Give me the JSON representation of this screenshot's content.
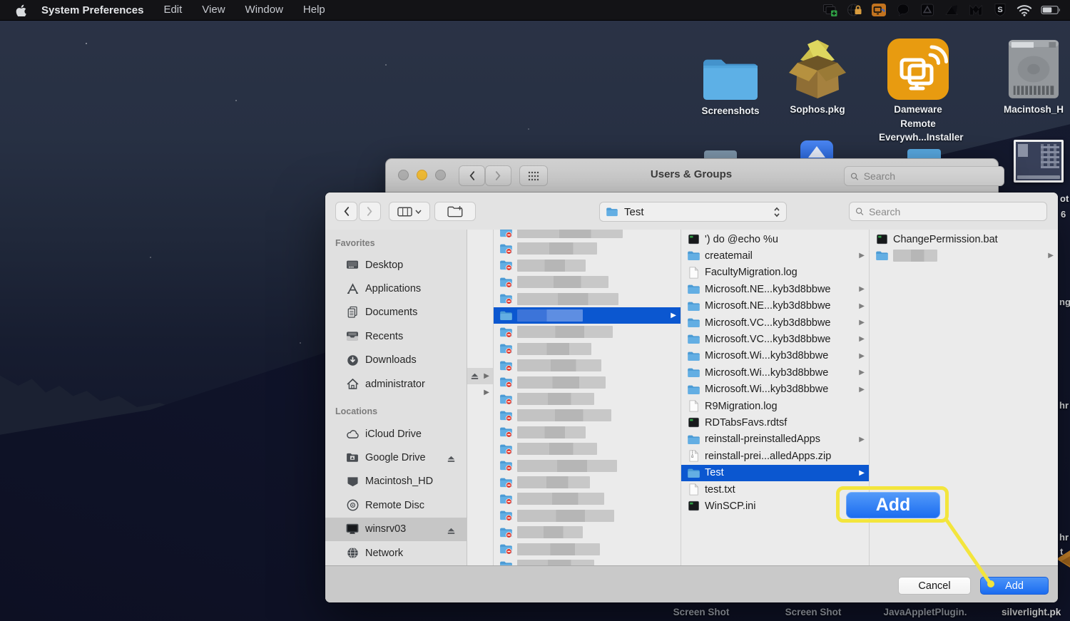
{
  "menu_bar": {
    "app_name": "System Preferences",
    "menus": [
      "Edit",
      "View",
      "Window",
      "Help"
    ],
    "status_icons": [
      "screen-sharing-icon",
      "globe-lock-icon",
      "dameware-tray-icon",
      "chat-bubble-icon",
      "google-drive-icon",
      "angular-shape-icon",
      "malwarebytes-icon",
      "sophos-shield-icon",
      "wifi-icon",
      "battery-icon"
    ]
  },
  "desktop": {
    "top_icons": [
      {
        "label": "Screenshots",
        "icon": "folder"
      },
      {
        "label": "Sophos.pkg",
        "icon": "package"
      },
      {
        "label": "Dameware Remote\nEverywh...Installer",
        "icon": "dameware-app"
      },
      {
        "label": "Macintosh_H",
        "icon": "hard-drive"
      }
    ],
    "bottom_labels": [
      "Screen Shot",
      "Screen Shot",
      "JavaAppletPlugin.",
      "silverlight.pk"
    ],
    "edge_fragments": [
      "ot",
      "6",
      "ng",
      "hr",
      "hr",
      "t"
    ]
  },
  "prefs_window": {
    "title": "Users & Groups",
    "search_placeholder": "Search"
  },
  "dialog": {
    "popup_value": "Test",
    "search_placeholder": "Search",
    "sidebar": {
      "favorites_header": "Favorites",
      "favorites": [
        {
          "label": "Desktop",
          "icon": "desktop"
        },
        {
          "label": "Applications",
          "icon": "applications"
        },
        {
          "label": "Documents",
          "icon": "documents"
        },
        {
          "label": "Recents",
          "icon": "recents"
        },
        {
          "label": "Downloads",
          "icon": "downloads"
        },
        {
          "label": "administrator",
          "icon": "home"
        }
      ],
      "locations_header": "Locations",
      "locations": [
        {
          "label": "iCloud Drive",
          "icon": "icloud",
          "eject": false,
          "selected": false
        },
        {
          "label": "Google Drive",
          "icon": "gdrive",
          "eject": true,
          "selected": false
        },
        {
          "label": "Macintosh_HD",
          "icon": "internal-drive",
          "eject": false,
          "selected": false
        },
        {
          "label": "Remote Disc",
          "icon": "remote-disc",
          "eject": false,
          "selected": false
        },
        {
          "label": "winsrv03",
          "icon": "server",
          "eject": true,
          "selected": true
        },
        {
          "label": "Network",
          "icon": "network",
          "eject": false,
          "selected": false
        }
      ]
    },
    "columns": {
      "blurred_row_count": 21,
      "blurred_selected_index": 5,
      "files": [
        {
          "name": "') do @echo %u",
          "icon": "script",
          "arrow": false,
          "selected": false
        },
        {
          "name": "createmail",
          "icon": "folder",
          "arrow": true,
          "selected": false
        },
        {
          "name": "FacultyMigration.log",
          "icon": "doc",
          "arrow": false,
          "selected": false
        },
        {
          "name": "Microsoft.NE...kyb3d8bbwe",
          "icon": "folder",
          "arrow": true,
          "selected": false
        },
        {
          "name": "Microsoft.NE...kyb3d8bbwe",
          "icon": "folder",
          "arrow": true,
          "selected": false
        },
        {
          "name": "Microsoft.VC...kyb3d8bbwe",
          "icon": "folder",
          "arrow": true,
          "selected": false
        },
        {
          "name": "Microsoft.VC...kyb3d8bbwe",
          "icon": "folder",
          "arrow": true,
          "selected": false
        },
        {
          "name": "Microsoft.Wi...kyb3d8bbwe",
          "icon": "folder",
          "arrow": true,
          "selected": false
        },
        {
          "name": "Microsoft.Wi...kyb3d8bbwe",
          "icon": "folder",
          "arrow": true,
          "selected": false
        },
        {
          "name": "Microsoft.Wi...kyb3d8bbwe",
          "icon": "folder",
          "arrow": true,
          "selected": false
        },
        {
          "name": "R9Migration.log",
          "icon": "doc",
          "arrow": false,
          "selected": false
        },
        {
          "name": "RDTabsFavs.rdtsf",
          "icon": "script",
          "arrow": false,
          "selected": false
        },
        {
          "name": "reinstall-preinstalledApps",
          "icon": "folder",
          "arrow": true,
          "selected": false
        },
        {
          "name": "reinstall-prei...alledApps.zip",
          "icon": "zip",
          "arrow": false,
          "selected": false
        },
        {
          "name": "Test",
          "icon": "folder",
          "arrow": true,
          "selected": true
        },
        {
          "name": "test.txt",
          "icon": "doc",
          "arrow": false,
          "selected": false
        },
        {
          "name": "WinSCP.ini",
          "icon": "script",
          "arrow": false,
          "selected": false
        }
      ],
      "files_col4": [
        {
          "name": "ChangePermission.bat",
          "icon": "script",
          "arrow": false,
          "selected": false,
          "redacted": false
        },
        {
          "name": "",
          "icon": "folder",
          "arrow": true,
          "selected": false,
          "redacted": true
        }
      ]
    },
    "cancel_label": "Cancel",
    "add_label": "Add"
  },
  "callout": {
    "label": "Add"
  },
  "colors": {
    "selection_blue": "#0b57d0",
    "button_blue": "#1b6cf0",
    "callout_yellow": "#f3e53c",
    "folder_blue": "#57a7de",
    "menubar_black": "#131316"
  }
}
